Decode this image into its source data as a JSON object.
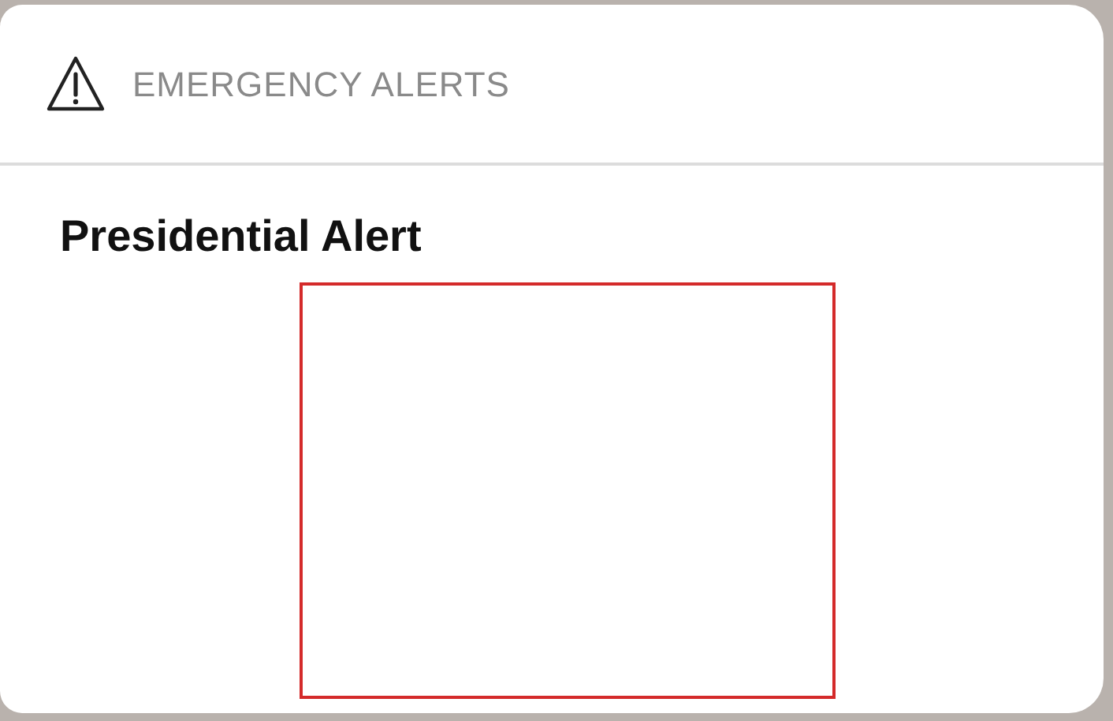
{
  "notification": {
    "app_name": "EMERGENCY ALERTS",
    "title": "Presidential Alert"
  }
}
